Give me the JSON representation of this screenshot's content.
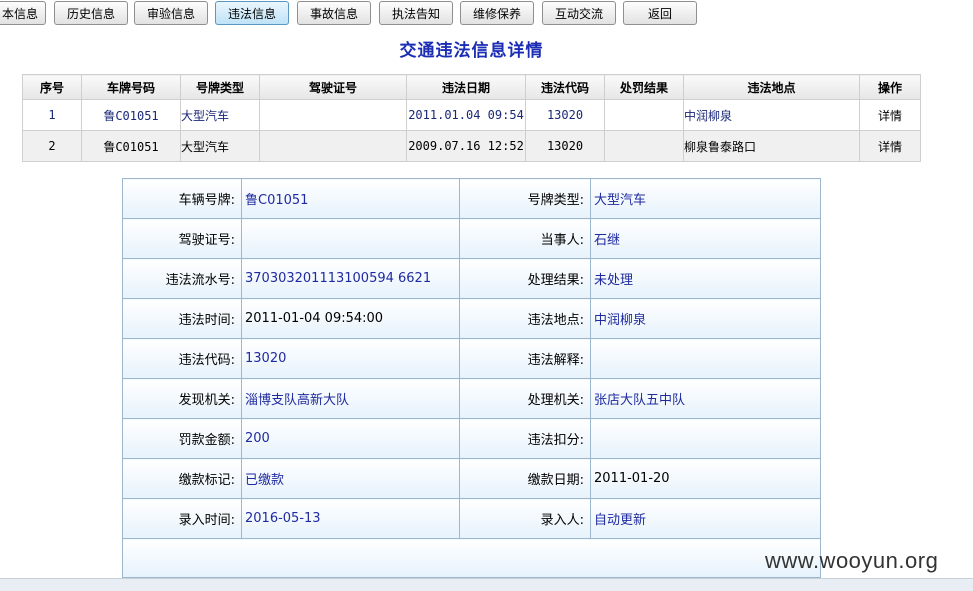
{
  "tabs": [
    "本信息",
    "历史信息",
    "审验信息",
    "违法信息",
    "事故信息",
    "执法告知",
    "维修保养",
    "互动交流",
    "返回"
  ],
  "page_title": "交通违法信息详情",
  "table": {
    "headers": [
      "序号",
      "车牌号码",
      "号牌类型",
      "驾驶证号",
      "违法日期",
      "违法代码",
      "处罚结果",
      "违法地点",
      "操作"
    ],
    "rows": [
      {
        "no": "1",
        "plate": "鲁C01051",
        "type": "大型汽车",
        "license": "",
        "date": "2011.01.04 09:54",
        "code": "13020",
        "result": "",
        "place": "中润柳泉",
        "action": "详情"
      },
      {
        "no": "2",
        "plate": "鲁C01051",
        "type": "大型汽车",
        "license": "",
        "date": "2009.07.16 12:52",
        "code": "13020",
        "result": "",
        "place": "柳泉鲁泰路口",
        "action": "详情"
      }
    ]
  },
  "detail": [
    {
      "l1": "车辆号牌:",
      "v1": "鲁C01051",
      "l2": "号牌类型:",
      "v2": "大型汽车"
    },
    {
      "l1": "驾驶证号:",
      "v1": "",
      "l2": "当事人:",
      "v2": "石继"
    },
    {
      "l1": "违法流水号:",
      "v1": "370303201113100594 6621",
      "l2": "处理结果:",
      "v2": "未处理"
    },
    {
      "l1": "违法时间:",
      "v1": "2011-01-04 09:54:00",
      "l2": "违法地点:",
      "v2": "中润柳泉"
    },
    {
      "l1": "违法代码:",
      "v1": "13020",
      "l2": "违法解释:",
      "v2": ""
    },
    {
      "l1": "发现机关:",
      "v1": "淄博支队高新大队",
      "l2": "处理机关:",
      "v2": "张店大队五中队"
    },
    {
      "l1": "罚款金额:",
      "v1": "200",
      "l2": "违法扣分:",
      "v2": ""
    },
    {
      "l1": "缴款标记:",
      "v1": "已缴款",
      "l2": "缴款日期:",
      "v2": "2011-01-20"
    },
    {
      "l1": "录入时间:",
      "v1": "2016-05-13",
      "l2": "录入人:",
      "v2": "自动更新"
    }
  ],
  "watermark": "www.wooyun.org"
}
